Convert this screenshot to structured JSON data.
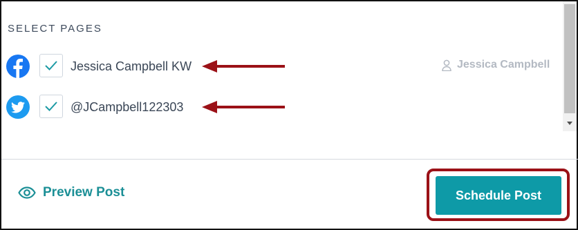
{
  "section_title": "SELECT PAGES",
  "pages": [
    {
      "network": "facebook",
      "icon": "facebook-icon",
      "checked": true,
      "name": "Jessica Campbell KW",
      "owner": "Jessica Campbell"
    },
    {
      "network": "twitter",
      "icon": "twitter-icon",
      "checked": true,
      "name": "@JCampbell122303",
      "owner": ""
    }
  ],
  "footer": {
    "preview_label": "Preview Post",
    "schedule_label": "Schedule Post"
  },
  "colors": {
    "accent": "#0e9aa7",
    "annotation": "#9b1117",
    "facebook": "#1877f2",
    "twitter": "#1d9bf0"
  }
}
